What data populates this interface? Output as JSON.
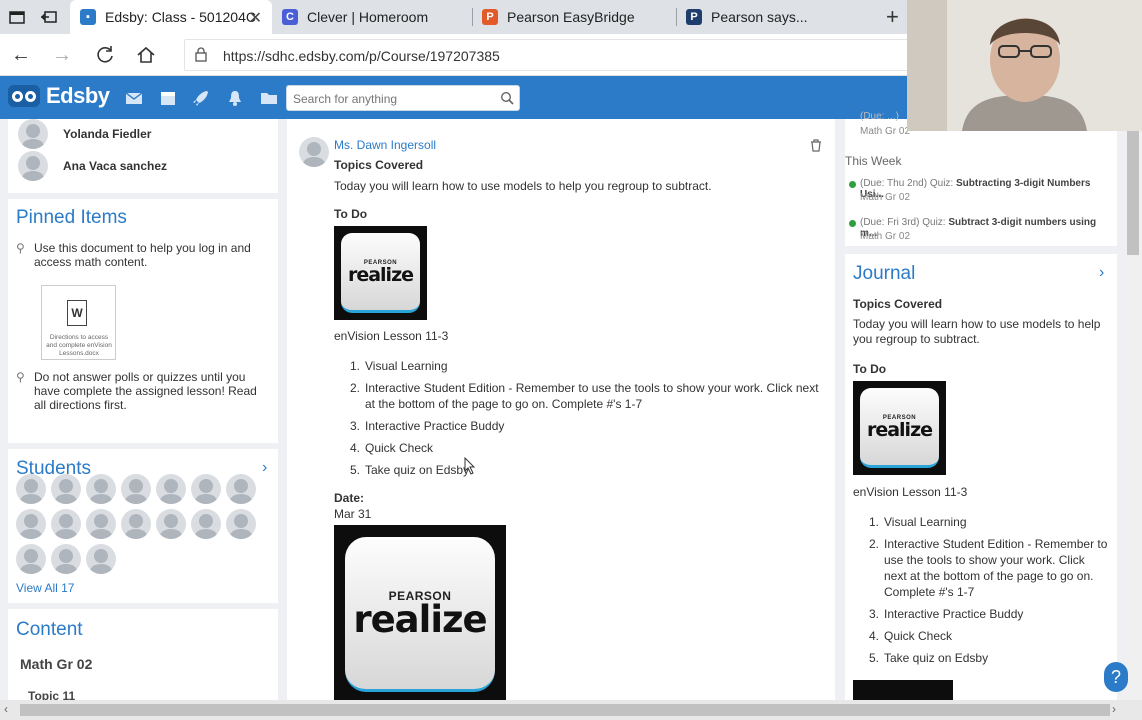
{
  "browser": {
    "tabs": [
      {
        "title": "Edsby: Class - 501204C",
        "active": true,
        "favicon": "edsby-favicon",
        "color": "#2b7bc8"
      },
      {
        "title": "Clever | Homeroom",
        "active": false,
        "favicon": "clever-favicon",
        "color": "#4a5fd6"
      },
      {
        "title": "Pearson EasyBridge",
        "active": false,
        "favicon": "pearson-favicon",
        "color": "#e2592a"
      },
      {
        "title": "Pearson says...",
        "active": false,
        "favicon": "pearson-p-favicon",
        "color": "#1f3e6e"
      }
    ],
    "url": "https://sdhc.edsby.com/p/Course/197207385"
  },
  "edsby": {
    "logo": "Edsby",
    "search_placeholder": "Search for anything"
  },
  "left": {
    "people": [
      "Yolanda Fiedler",
      "Ana Vaca sanchez"
    ],
    "pinned_title": "Pinned Items",
    "pinned": [
      "Use this document to help you log in and access math content.",
      "Do not answer polls or quizzes until you have complete the assigned lesson! Read all directions first."
    ],
    "doc_caption": "Directions to access and complete enVision Lessons.docx",
    "students_title": "Students",
    "student_count": 17,
    "view_all": "View All 17",
    "content_title": "Content",
    "content_course": "Math Gr 02",
    "content_topic": "Topic 11"
  },
  "post": {
    "author": "Ms. Dawn Ingersoll",
    "topics_label": "Topics Covered",
    "topics_text": "Today you will learn how to use models to help you regroup to subtract.",
    "todo_label": "To Do",
    "lesson": "enVision Lesson 11-3",
    "steps": [
      "Visual Learning",
      "Interactive Student Edition - Remember to use the tools to show your work.  Click next at the bottom of the page to go on.  Complete #'s 1-7",
      "Interactive Practice Buddy",
      "Quick Check",
      "Take quiz on Edsby"
    ],
    "date_label": "Date:",
    "date": "Mar 31",
    "realize_brand": "PEARSON",
    "realize_word": "realize"
  },
  "right": {
    "top_course": "Math Gr 02",
    "top_partial": "(Due: ...)",
    "this_week": "This Week",
    "due_items": [
      {
        "due": "(Due: Thu 2nd) Quiz:",
        "title": "Subtracting 3-digit Numbers Usi...",
        "course": "Math Gr 02"
      },
      {
        "due": "(Due: Fri 3rd) Quiz:",
        "title": "Subtract 3-digit numbers using m...",
        "course": "Math Gr 02"
      }
    ],
    "journal_title": "Journal",
    "journal_topics": "Topics Covered",
    "journal_text": "Today you will learn how to use models to help you regroup to subtract.",
    "journal_todo": "To Do",
    "journal_lesson": "enVision Lesson 11-3",
    "journal_steps": [
      "Visual Learning",
      "Interactive Student Edition - Remember to use the tools to show your work.  Click next at the bottom of the page to go on.  Complete #'s 1-7",
      "Interactive Practice Buddy",
      "Quick Check",
      "Take quiz on Edsby"
    ]
  },
  "help": "?"
}
